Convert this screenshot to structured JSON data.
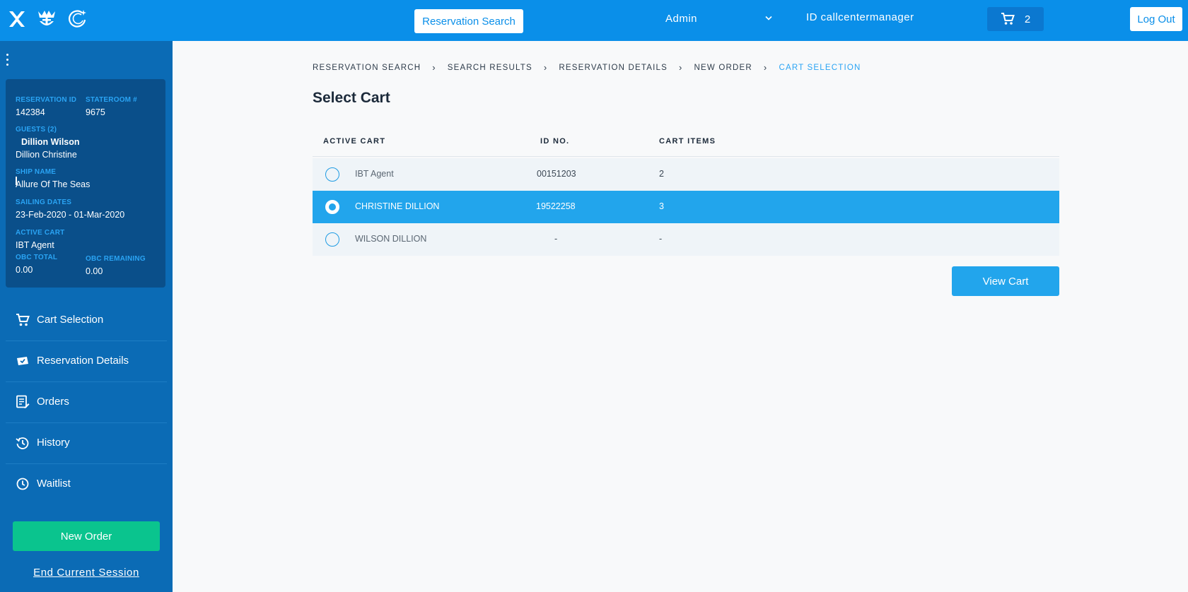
{
  "header": {
    "reservation_search_label": "Reservation Search",
    "role": "Admin",
    "user_id": "ID callcentermanager",
    "cart_count": "2",
    "logout_label": "Log Out"
  },
  "sidebar": {
    "info": {
      "reservation_id_label": "RESERVATION ID",
      "reservation_id": "142384",
      "stateroom_label": "STATEROOM #",
      "stateroom": "9675",
      "guests_label": "GUESTS (2)",
      "guest_primary": "Dillion Wilson",
      "guest_secondary": "Dillion Christine",
      "ship_name_label": "SHIP NAME",
      "ship_name": "Allure Of The Seas",
      "sailing_dates_label": "SAILING DATES",
      "sailing_dates": "23-Feb-2020 - 01-Mar-2020",
      "active_cart_label": "ACTIVE CART",
      "active_cart": "IBT Agent",
      "obc_total_label": "OBC TOTAL",
      "obc_total": "0.00",
      "obc_remaining_label": "OBC REMAINING",
      "obc_remaining": "0.00"
    },
    "nav": [
      {
        "label": "Cart Selection",
        "icon": "cart-icon"
      },
      {
        "label": "Reservation Details",
        "icon": "ticket-icon"
      },
      {
        "label": "Orders",
        "icon": "orders-icon"
      },
      {
        "label": "History",
        "icon": "history-icon"
      },
      {
        "label": "Waitlist",
        "icon": "clock-icon"
      }
    ],
    "new_order_label": "New Order",
    "end_session_label": "End Current Session"
  },
  "breadcrumb": [
    "RESERVATION SEARCH",
    "SEARCH RESULTS",
    "RESERVATION DETAILS",
    "NEW ORDER",
    "CART SELECTION"
  ],
  "page_title": "Select Cart",
  "table": {
    "headers": [
      "ACTIVE CART",
      "ID NO.",
      "CART ITEMS"
    ],
    "rows": [
      {
        "name": "IBT Agent",
        "id": "00151203",
        "items": "2",
        "selected": false
      },
      {
        "name": "CHRISTINE DILLION",
        "id": "19522258",
        "items": "3",
        "selected": true
      },
      {
        "name": "WILSON DILLION",
        "id": "-",
        "items": "-",
        "selected": false
      }
    ]
  },
  "view_cart_label": "View Cart",
  "colors": {
    "header_bg": "#0a8fe9",
    "sidebar_bg": "#0b6bb5",
    "selected_row": "#22a5ec",
    "new_order": "#0ac48e"
  }
}
